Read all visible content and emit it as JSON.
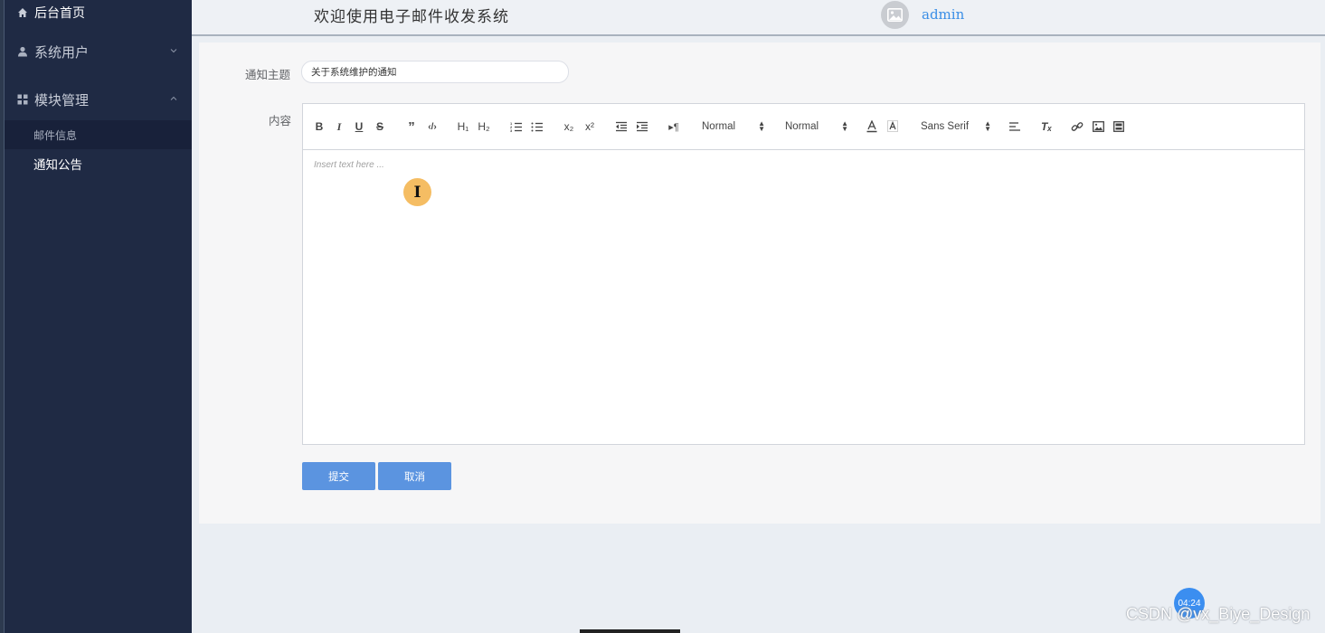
{
  "sidebar": {
    "home_label": "后台首页",
    "users_label": "系统用户",
    "modules_label": "模块管理",
    "submenu": [
      {
        "label": "邮件信息"
      },
      {
        "label": "通知公告"
      }
    ]
  },
  "header": {
    "title": "欢迎使用电子邮件收发系统",
    "username": "admin"
  },
  "form": {
    "subject_label": "通知主题",
    "subject_value": "关于系统维护的通知",
    "content_label": "内容",
    "editor_placeholder": "Insert text here ...",
    "toolbar": {
      "bold": "B",
      "italic": "I",
      "underline": "U",
      "strike": "S",
      "blockquote": "”",
      "code": "‹/›",
      "h1": "H₁",
      "h2": "H₂",
      "subscript": "x₂",
      "superscript": "x²",
      "direction": "▸¶",
      "size_value": "Normal",
      "header_value": "Normal",
      "font_value": "Sans Serif",
      "clean": "Tₓ"
    },
    "submit_label": "提交",
    "cancel_label": "取消"
  },
  "overlay": {
    "cursor_glyph": "I",
    "clock": "04:24",
    "watermark": "CSDN @vx_Biye_Design"
  },
  "colors": {
    "sidebar_bg": "#1f2a44",
    "accent": "#5b94e0",
    "username": "#3a8ee6",
    "cursor_highlight": "#f5bd63"
  }
}
